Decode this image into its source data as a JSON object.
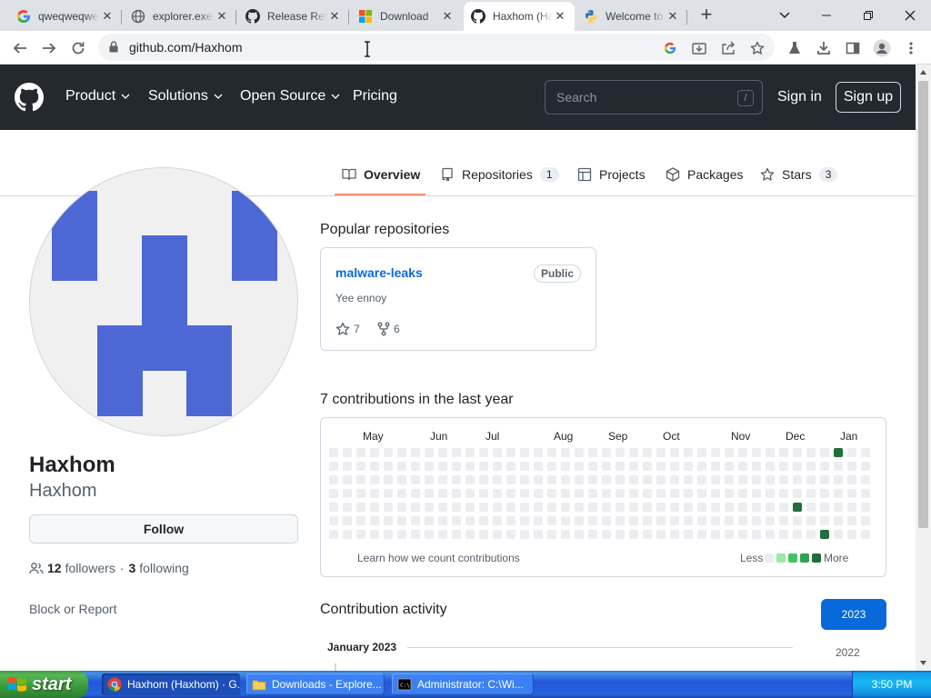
{
  "browser": {
    "tabs": [
      {
        "title": "qweqweqwe",
        "icon": "google-icon"
      },
      {
        "title": "explorer.exe",
        "icon": "globe-icon"
      },
      {
        "title": "Release Ref",
        "icon": "github-icon"
      },
      {
        "title": "Download",
        "icon": "windows-icon"
      },
      {
        "title": "Haxhom (Haxhom)",
        "icon": "github-icon",
        "active": true
      },
      {
        "title": "Welcome to",
        "icon": "python-icon"
      }
    ],
    "url": "github.com/Haxhom"
  },
  "github_header": {
    "nav": [
      "Product",
      "Solutions",
      "Open Source",
      "Pricing"
    ],
    "search_placeholder": "Search",
    "search_shortcut": "/",
    "signin": "Sign in",
    "signup": "Sign up"
  },
  "profile_nav": {
    "overview": "Overview",
    "repositories": "Repositories",
    "repositories_count": "1",
    "projects": "Projects",
    "packages": "Packages",
    "stars": "Stars",
    "stars_count": "3"
  },
  "profile": {
    "fullname": "Haxhom",
    "username": "Haxhom",
    "follow": "Follow",
    "followers_count": "12",
    "followers_label": "followers",
    "separator": "·",
    "following_count": "3",
    "following_label": "following",
    "block_report": "Block or Report"
  },
  "popular": {
    "title": "Popular repositories",
    "repo": {
      "name": "malware-leaks",
      "visibility": "Public",
      "description": "Yee ennoy",
      "stars": "7",
      "forks": "6"
    }
  },
  "contributions": {
    "title": "7 contributions in the last year",
    "months": [
      "May",
      "Jun",
      "Jul",
      "Aug",
      "Sep",
      "Oct",
      "Nov",
      "Dec",
      "Jan"
    ],
    "learn": "Learn how we count contributions",
    "less": "Less",
    "more": "More",
    "colors": [
      "#ebedf0",
      "#9be9a8",
      "#40c463",
      "#30a14e",
      "#216e39"
    ],
    "weeks": 40,
    "filled_cells": [
      {
        "week": 37,
        "day": 0,
        "level": 4
      },
      {
        "week": 34,
        "day": 4,
        "level": 4
      },
      {
        "week": 36,
        "day": 6,
        "level": 4
      }
    ]
  },
  "activity": {
    "title": "Contribution activity",
    "years": [
      "2023",
      "2022"
    ],
    "month": "January 2023"
  },
  "taskbar": {
    "start": "start",
    "tasks": [
      "Haxhom (Haxhom) · G...",
      "Downloads - Explore...",
      "Administrator: C:\\Wi..."
    ],
    "clock": "3:50 PM"
  }
}
